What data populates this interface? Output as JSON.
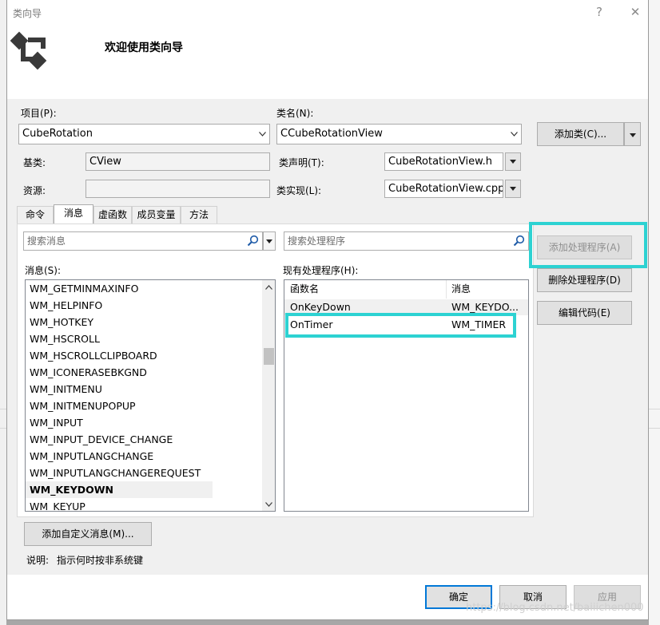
{
  "window": {
    "title": "类向导",
    "help_label": "?",
    "close_label": "✕",
    "welcome": "欢迎使用类向导"
  },
  "form": {
    "project_label": "项目(P):",
    "project_value": "CubeRotation",
    "classname_label": "类名(N):",
    "classname_value": "CCubeRotationView",
    "add_class_label": "添加类(C)...",
    "base_label": "基类:",
    "base_value": "CView",
    "resource_label": "资源:",
    "resource_value": "",
    "class_decl_label": "类声明(T):",
    "class_decl_value": "CubeRotationView.h",
    "class_impl_label": "类实现(L):",
    "class_impl_value": "CubeRotationView.cpp"
  },
  "tabs": [
    "命令",
    "消息",
    "虚函数",
    "成员变量",
    "方法"
  ],
  "active_tab": "消息",
  "messages": {
    "search_placeholder": "搜索消息",
    "label": "消息(S):",
    "items": [
      "WM_GETMINMAXINFO",
      "WM_HELPINFO",
      "WM_HOTKEY",
      "WM_HSCROLL",
      "WM_HSCROLLCLIPBOARD",
      "WM_ICONERASEBKGND",
      "WM_INITMENU",
      "WM_INITMENUPOPUP",
      "WM_INPUT",
      "WM_INPUT_DEVICE_CHANGE",
      "WM_INPUTLANGCHANGE",
      "WM_INPUTLANGCHANGEREQUEST",
      "WM_KEYDOWN",
      "WM_KEYUP"
    ],
    "selected": "WM_KEYDOWN"
  },
  "handlers": {
    "search_placeholder": "搜索处理程序",
    "label": "现有处理程序(H):",
    "col_function": "函数名",
    "col_message": "消息",
    "rows": [
      {
        "function": "OnKeyDown",
        "message": "WM_KEYDO..."
      },
      {
        "function": "OnTimer",
        "message": "WM_TIMER"
      }
    ]
  },
  "buttons": {
    "add_handler": "添加处理程序(A)",
    "delete_handler": "删除处理程序(D)",
    "edit_code": "编辑代码(E)",
    "add_custom_message": "添加自定义消息(M)...",
    "ok": "确定",
    "cancel": "取消",
    "apply": "应用"
  },
  "description": {
    "label": "说明:",
    "text": "指示何时按非系统键"
  },
  "watermark": "https://blog.csdn.net/baiiichen000",
  "colors": {
    "highlight": "#2dd2d2",
    "accent": "#0078d7"
  }
}
